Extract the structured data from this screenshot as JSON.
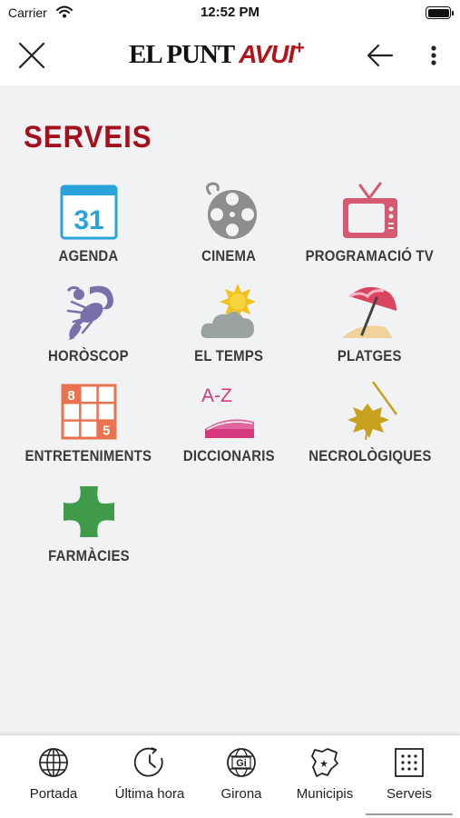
{
  "status": {
    "carrier": "Carrier",
    "time": "12:52 PM"
  },
  "header": {
    "logo_main": "EL PUNT",
    "logo_accent": "AVUI",
    "logo_plus": "+"
  },
  "section": {
    "title": "SERVEIS"
  },
  "services": [
    {
      "label": "AGENDA",
      "icon": "calendar-icon",
      "badge": "31"
    },
    {
      "label": "CINEMA",
      "icon": "film-reel-icon"
    },
    {
      "label": "PROGRAMACIÓ TV",
      "icon": "television-icon"
    },
    {
      "label": "HORÒSCOP",
      "icon": "scorpion-icon"
    },
    {
      "label": "EL TEMPS",
      "icon": "weather-icon"
    },
    {
      "label": "PLATGES",
      "icon": "beach-umbrella-icon"
    },
    {
      "label": "ENTRETENIMENTS",
      "icon": "sudoku-icon",
      "digits": [
        "8",
        "5"
      ]
    },
    {
      "label": "DICCIONARIS",
      "icon": "dictionary-icon",
      "badge": "A-Z"
    },
    {
      "label": "NECROLÒGIQUES",
      "icon": "leaf-icon"
    },
    {
      "label": "FARMÀCIES",
      "icon": "pharmacy-cross-icon"
    }
  ],
  "tabs": [
    {
      "label": "Portada",
      "icon": "globe-icon",
      "active": false
    },
    {
      "label": "Última hora",
      "icon": "clock-icon",
      "active": false
    },
    {
      "label": "Girona",
      "icon": "girona-globe-icon",
      "badge": "Gi",
      "active": false
    },
    {
      "label": "Municipis",
      "icon": "map-icon",
      "active": false
    },
    {
      "label": "Serveis",
      "icon": "grid-icon",
      "active": true
    }
  ],
  "colors": {
    "brand": "#b3131d",
    "title": "#a3111e",
    "background": "#f1f2f4",
    "agenda": "#2aa3dc",
    "cinema": "#8e8e8e",
    "tv": "#d65a6f",
    "horoscope": "#7b6fab",
    "weather_sun": "#f2c21b",
    "weather_cloud": "#9aa3a2",
    "beach": "#d9455f",
    "sudoku": "#e8734e",
    "dictionary": "#d6397d",
    "necrology": "#c8a21e",
    "pharmacy": "#3f9a4a"
  }
}
